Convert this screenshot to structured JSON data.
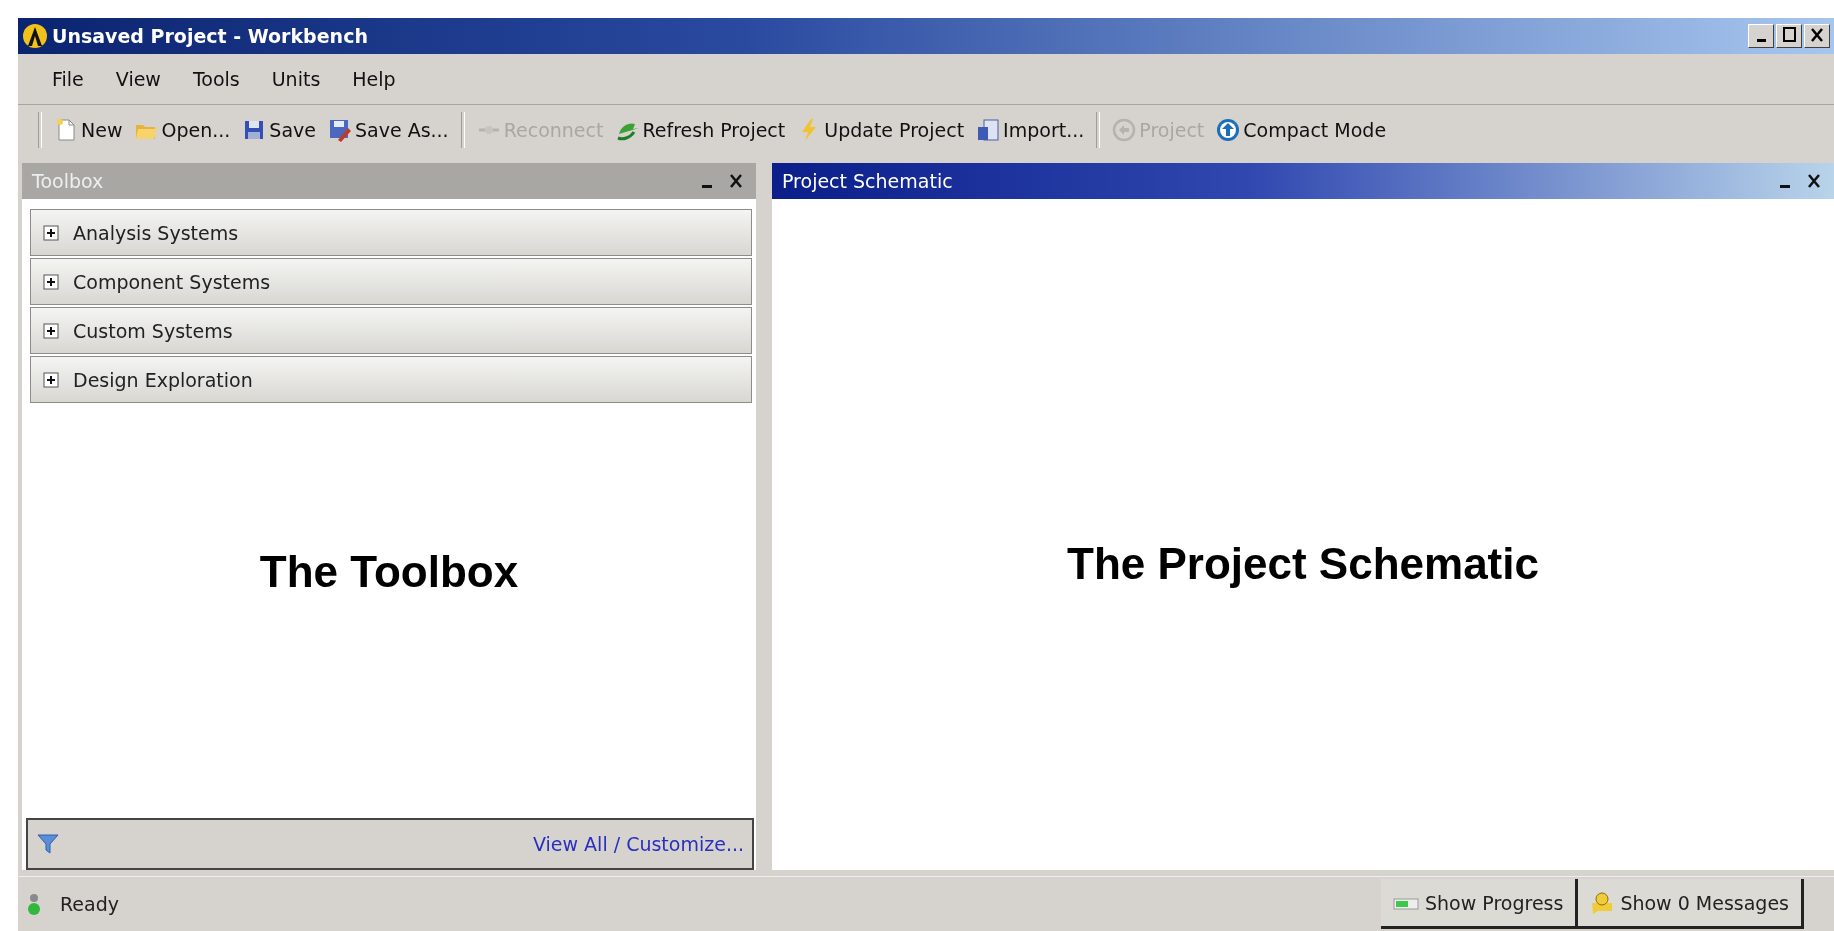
{
  "window": {
    "title": "Unsaved Project - Workbench"
  },
  "menu": [
    "File",
    "View",
    "Tools",
    "Units",
    "Help"
  ],
  "toolbar": [
    {
      "items": [
        {
          "label": "New",
          "disabled": false
        },
        {
          "label": "Open...",
          "disabled": false
        },
        {
          "label": "Save",
          "disabled": false
        },
        {
          "label": "Save As...",
          "disabled": false
        }
      ]
    },
    {
      "items": [
        {
          "label": "Reconnect",
          "disabled": true
        },
        {
          "label": "Refresh Project",
          "disabled": false
        },
        {
          "label": "Update Project",
          "disabled": false
        },
        {
          "label": "Import...",
          "disabled": false
        }
      ]
    },
    {
      "items": [
        {
          "label": "Project",
          "disabled": true
        },
        {
          "label": "Compact Mode",
          "disabled": false
        }
      ]
    }
  ],
  "toolbox": {
    "title": "Toolbox",
    "active": false,
    "groups": [
      {
        "label": "Analysis Systems",
        "expanded": false
      },
      {
        "label": "Component Systems",
        "expanded": false
      },
      {
        "label": "Custom Systems",
        "expanded": false
      },
      {
        "label": "Design Exploration",
        "expanded": false
      }
    ],
    "caption": "The Toolbox",
    "footer_link": "View All / Customize..."
  },
  "schematic": {
    "title": "Project Schematic",
    "active": true,
    "caption": "The Project Schematic"
  },
  "status_bar": {
    "status": "Ready",
    "buttons": [
      "Show Progress",
      "Show 0 Messages"
    ]
  }
}
